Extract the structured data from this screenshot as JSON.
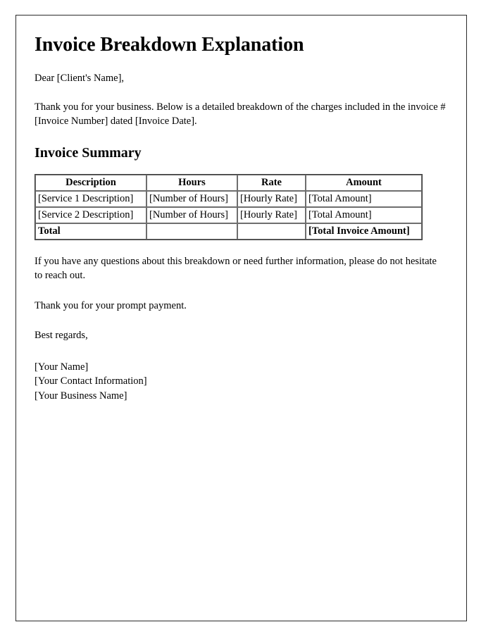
{
  "document": {
    "title": "Invoice Breakdown Explanation",
    "salutation": "Dear [Client's Name],",
    "intro_paragraph": "Thank you for your business. Below is a detailed breakdown of the charges included in the invoice # [Invoice Number] dated [Invoice Date].",
    "section_heading": "Invoice Summary",
    "closing_paragraph": "If you have any questions about this breakdown or need further information, please do not hesitate to reach out.",
    "thanks_paragraph": "Thank you for your prompt payment.",
    "regards": "Best regards,",
    "signature": {
      "name": "[Your Name]",
      "contact": "[Your Contact Information]",
      "business": "[Your Business Name]"
    }
  },
  "invoice_table": {
    "headers": [
      "Description",
      "Hours",
      "Rate",
      "Amount"
    ],
    "rows": [
      [
        "[Service 1 Description]",
        "[Number of Hours]",
        "[Hourly Rate]",
        "[Total Amount]"
      ],
      [
        "[Service 2 Description]",
        "[Number of Hours]",
        "[Hourly Rate]",
        "[Total Amount]"
      ]
    ],
    "total_row": [
      "Total",
      "",
      "",
      "[Total Invoice Amount]"
    ]
  },
  "colors": {
    "page_background": "#ffffff",
    "text": "#000000",
    "page_border": "#2b2b2b",
    "table_outer_border": "#3a3a3a",
    "table_cell_border": "#6e6e6e"
  }
}
